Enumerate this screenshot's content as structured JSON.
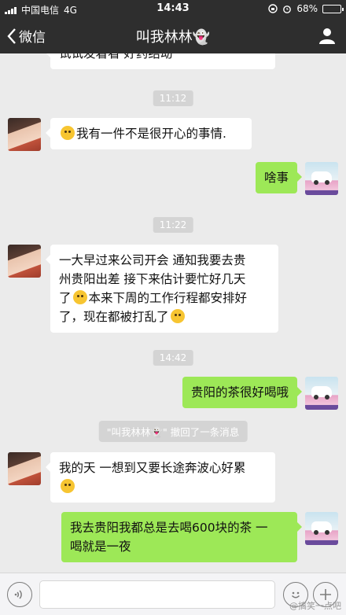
{
  "status_bar": {
    "carrier": "中国电信",
    "network": "4G",
    "time": "14:43",
    "battery": "68%",
    "battery_level": 0.68
  },
  "nav": {
    "back_label": "微信",
    "title": "叫我林林👻"
  },
  "messages": {
    "partial_top": "试试发着看 好药结动",
    "ts1": "11:12",
    "m1": "我有一件不是很开心的事情.",
    "m2": "啥事",
    "ts2": "11:22",
    "m3_line1": "一大早过来公司开会 通知我要去贵",
    "m3_line2": "州贵阳出差 接下来估计要忙好几天",
    "m3_line3a": "了",
    "m3_line3b": "本来下周的工作行程都安排好",
    "m3_line4": "了，现在都被打乱了",
    "ts3": "14:42",
    "m4": "贵阳的茶很好喝哦",
    "recall_notice": "\"叫我林林👻\" 撤回了一条消息",
    "m5_line1": "我的天 一想到又要长途奔波心好累",
    "m6_line1": "我去贵阳我都总是去喝600块的茶 一",
    "m6_line2": "喝就是一夜"
  },
  "watermark": "@搞笑一点吧",
  "colors": {
    "header_bg": "#2e2e2e",
    "chat_bg": "#ebebeb",
    "outgoing_bubble": "#9de857",
    "incoming_bubble": "#ffffff"
  },
  "icons": [
    "signal-icon",
    "alarm-icon",
    "lock-rotation-icon",
    "battery-icon",
    "back-chevron-icon",
    "profile-icon",
    "voice-icon",
    "emoji-icon",
    "plus-icon"
  ]
}
